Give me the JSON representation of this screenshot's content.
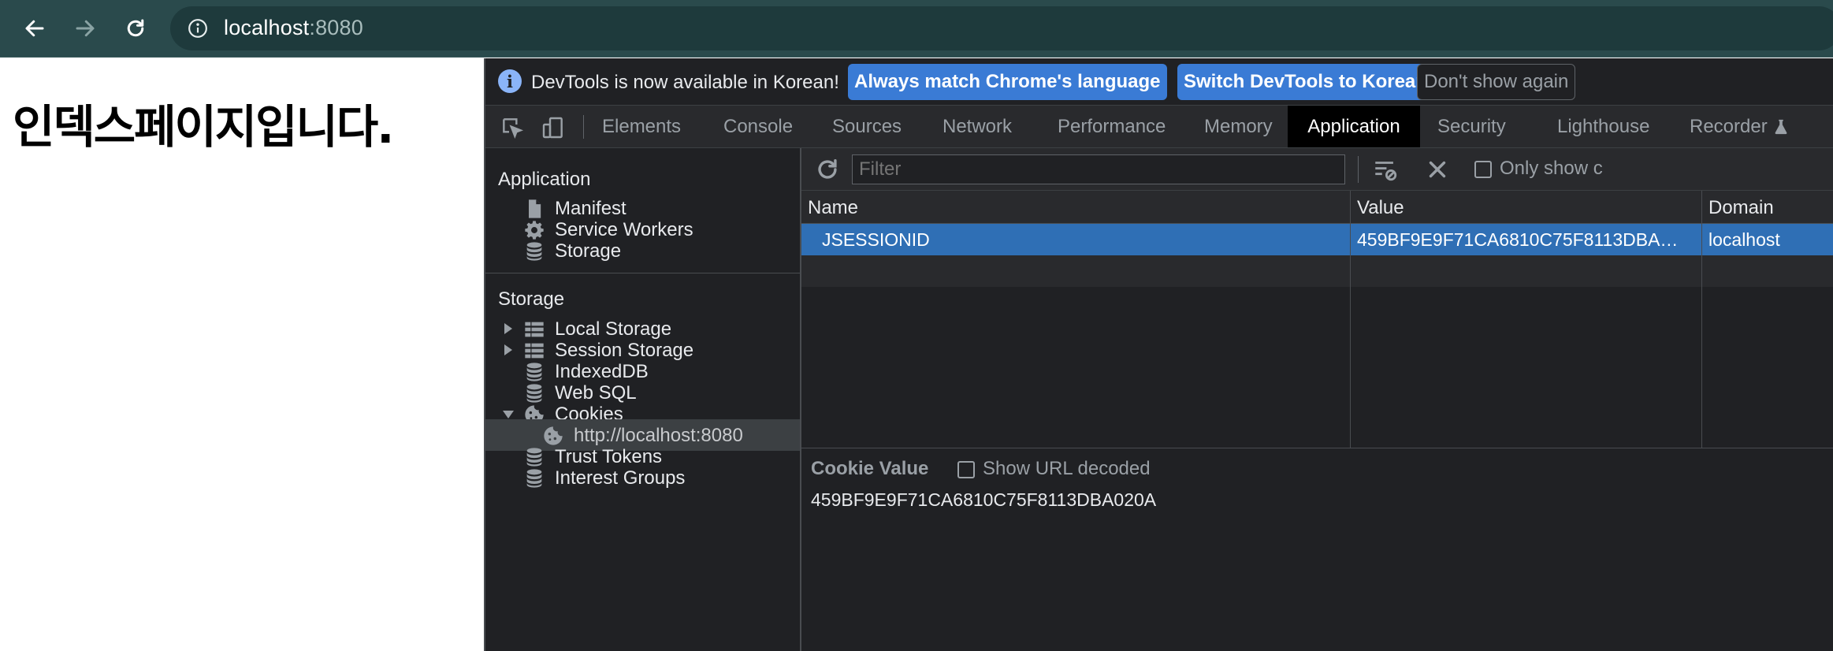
{
  "browser": {
    "url_host": "localhost",
    "url_port": ":8080"
  },
  "page": {
    "heading": "인덱스페이지입니다."
  },
  "infobar": {
    "message": "DevTools is now available in Korean!",
    "match_language": "Always match Chrome's language",
    "switch_korean": "Switch DevTools to Korean",
    "dont_show": "Don't show again"
  },
  "tabs": [
    {
      "label": "Elements"
    },
    {
      "label": "Console"
    },
    {
      "label": "Sources"
    },
    {
      "label": "Network"
    },
    {
      "label": "Performance"
    },
    {
      "label": "Memory"
    },
    {
      "label": "Application"
    },
    {
      "label": "Security"
    },
    {
      "label": "Lighthouse"
    },
    {
      "label": "Recorder"
    }
  ],
  "sidebar": {
    "application_header": "Application",
    "application_items": [
      {
        "label": "Manifest",
        "icon": "file-icon"
      },
      {
        "label": "Service Workers",
        "icon": "gear-icon"
      },
      {
        "label": "Storage",
        "icon": "database-icon"
      }
    ],
    "storage_header": "Storage",
    "storage_items": [
      {
        "label": "Local Storage",
        "icon": "table-icon"
      },
      {
        "label": "Session Storage",
        "icon": "table-icon"
      },
      {
        "label": "IndexedDB",
        "icon": "database-icon"
      },
      {
        "label": "Web SQL",
        "icon": "database-icon"
      },
      {
        "label": "Cookies",
        "icon": "cookie-icon"
      },
      {
        "label": "http://localhost:8080",
        "icon": "cookie-icon"
      },
      {
        "label": "Trust Tokens",
        "icon": "database-icon"
      },
      {
        "label": "Interest Groups",
        "icon": "database-icon"
      }
    ]
  },
  "cookies": {
    "filter_placeholder": "Filter",
    "only_show": "Only show c",
    "columns": [
      "Name",
      "Value",
      "Domain"
    ],
    "rows": [
      {
        "name": "JSESSIONID",
        "value": "459BF9E9F71CA6810C75F8113DBA…",
        "domain": "localhost"
      }
    ],
    "cookie_value_title": "Cookie Value",
    "show_url_decoded": "Show URL decoded",
    "cookie_value": "459BF9E9F71CA6810C75F8113DBA020A"
  },
  "colors": {
    "toolbar": "#2a4a4c",
    "devtools_bg": "#202124",
    "selected_row": "#2f6fb5",
    "primary_button": "#3a7bd5"
  }
}
